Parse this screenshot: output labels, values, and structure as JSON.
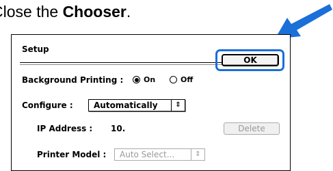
{
  "instruction": {
    "prefix": "Close the ",
    "bold": "Chooser",
    "suffix": "."
  },
  "dialog": {
    "title": "Setup",
    "ok_label": "OK",
    "background_printing": {
      "label": "Background Printing :",
      "options": [
        "On",
        "Off"
      ],
      "selected": "On"
    },
    "configure": {
      "label": "Configure :",
      "value": "Automatically"
    },
    "ip_address": {
      "label": "IP Address :",
      "value": "10."
    },
    "delete_label": "Delete",
    "printer_model": {
      "label": "Printer Model :",
      "value": "Auto Select..."
    }
  },
  "colors": {
    "highlight": "#1a6fd8",
    "arrow": "#1a6fd8"
  },
  "icons": {
    "pointer": "arrow-down-left-icon",
    "popup": "up-down-arrows-icon"
  }
}
